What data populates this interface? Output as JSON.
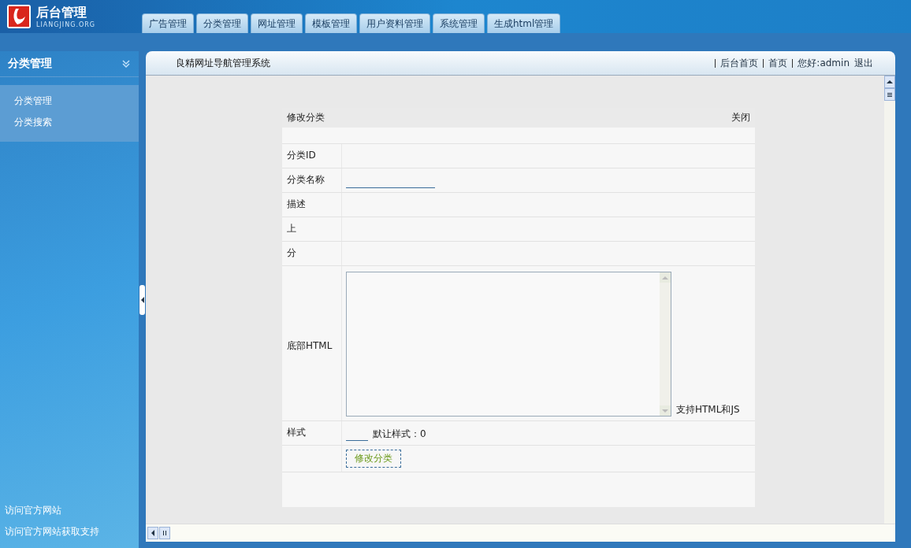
{
  "logo": {
    "title": "后台管理",
    "subtitle": "LIANGJING.ORG"
  },
  "tabs": [
    "广告管理",
    "分类管理",
    "网址管理",
    "模板管理",
    "用户资料管理",
    "系统管理",
    "生成html管理"
  ],
  "sidebar": {
    "title": "分类管理",
    "items": [
      {
        "label": "分类管理"
      },
      {
        "label": "分类搜索"
      }
    ],
    "footer_links": [
      "访问官方网站",
      "访问官方网站获取支持"
    ]
  },
  "topbar": {
    "title": "良精网址导航管理系统",
    "links": [
      "后台首页",
      "首页",
      "您好:admin",
      "退出"
    ]
  },
  "form": {
    "title": "修改分类",
    "close": "关闭",
    "rows": [
      {
        "kind": "text",
        "label": "分类ID"
      },
      {
        "kind": "input",
        "label": "分类名称"
      },
      {
        "kind": "text",
        "label": "描述"
      },
      {
        "kind": "text",
        "label": "上"
      },
      {
        "kind": "text",
        "label": "分"
      },
      {
        "kind": "textarea",
        "label": "底部HTML",
        "note": "支持HTML和JS"
      },
      {
        "kind": "small_input",
        "label": "样式",
        "note": "默让样式：0"
      },
      {
        "kind": "button",
        "label": "",
        "button": "修改分类"
      }
    ]
  }
}
